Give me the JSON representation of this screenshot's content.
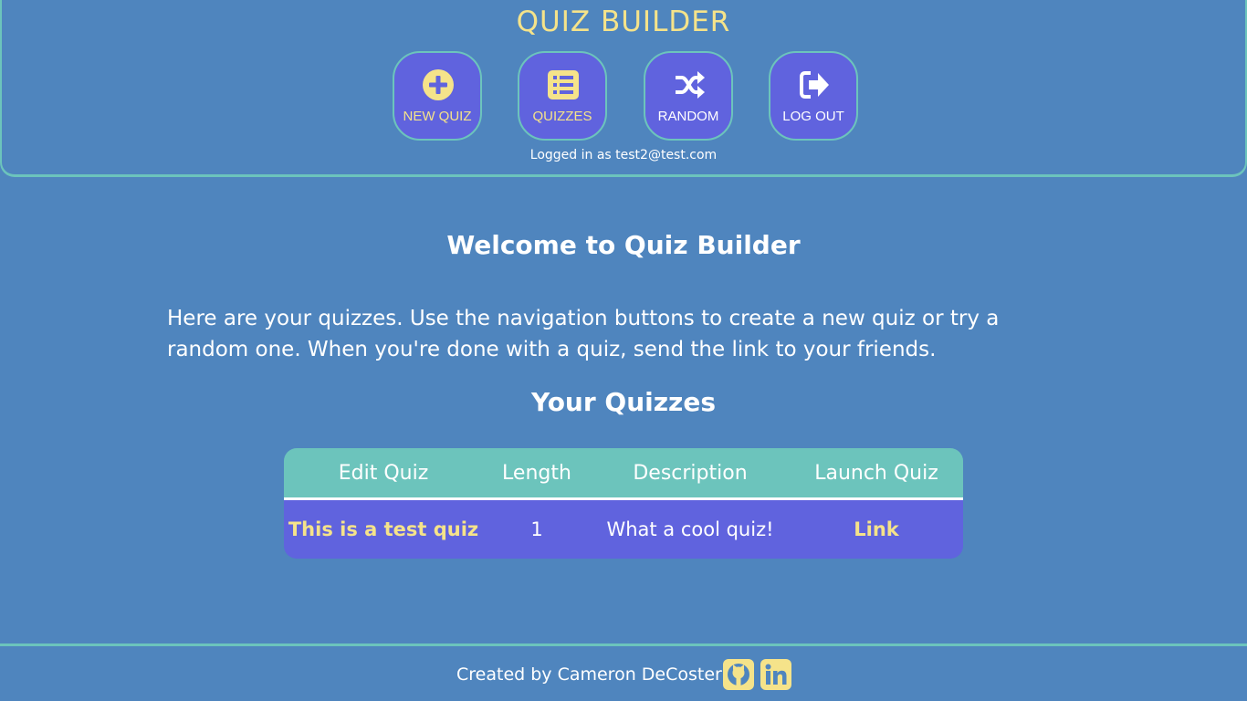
{
  "header": {
    "title": "QUIZ BUILDER",
    "logged_in": "Logged in as test2@test.com"
  },
  "nav": [
    {
      "label": "NEW QUIZ",
      "icon": "plus-circle-icon",
      "label_color": "#f5e38a"
    },
    {
      "label": "QUIZZES",
      "icon": "list-icon",
      "label_color": "#f5e38a"
    },
    {
      "label": "RANDOM",
      "icon": "shuffle-icon",
      "label_color": "#ffffff"
    },
    {
      "label": "LOG OUT",
      "icon": "sign-out-icon",
      "label_color": "#ffffff"
    }
  ],
  "main": {
    "welcome": "Welcome to Quiz Builder",
    "intro": "Here are your quizzes. Use the navigation buttons to create a new quiz or try a random one. When you're done with a quiz, send the link to your friends.",
    "quizzes_title": "Your Quizzes",
    "table": {
      "headers": [
        "Edit Quiz",
        "Length",
        "Description",
        "Launch Quiz"
      ],
      "rows": [
        {
          "title": "This is a test quiz",
          "length": "1",
          "description": "What a cool quiz!",
          "launch": "Link"
        }
      ]
    }
  },
  "footer": {
    "credit": "Created by Cameron DeCoster",
    "links": [
      {
        "icon": "github-icon"
      },
      {
        "icon": "linkedin-icon"
      }
    ]
  },
  "colors": {
    "background": "#4f85be",
    "accent_teal": "#6cc4bc",
    "button_purple": "#6063de",
    "highlight_yellow": "#f5e38a"
  }
}
